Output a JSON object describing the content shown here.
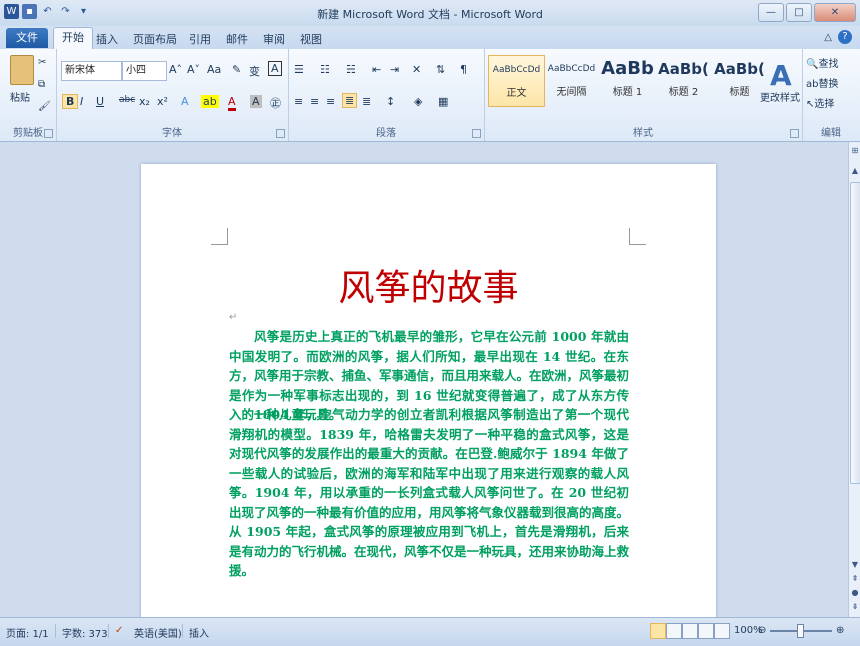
{
  "window": {
    "title": "新建 Microsoft Word 文档 - Microsoft Word",
    "controls": [
      "minimize-icon",
      "maximize-icon",
      "close-icon"
    ]
  },
  "quick_access": [
    "word-logo-icon",
    "save-icon",
    "undo-icon",
    "redo-icon",
    "customize-icon"
  ],
  "tabs": {
    "file": "文件",
    "items": [
      "开始",
      "插入",
      "页面布局",
      "引用",
      "邮件",
      "审阅",
      "视图"
    ],
    "active": "开始"
  },
  "ribbon": {
    "clipboard": {
      "paste": "粘贴",
      "label": "剪贴板"
    },
    "font": {
      "name": "新宋体",
      "size": "小四",
      "label": "字体",
      "buttons": [
        "B",
        "I",
        "U",
        "abc",
        "x₂",
        "x²",
        "A",
        "A",
        "A"
      ],
      "grow": "A˄",
      "shrink": "A˅",
      "case": "Aa",
      "pinyin": "变",
      "border": "A"
    },
    "paragraph": {
      "label": "段落"
    },
    "styles": {
      "label": "样式",
      "items": [
        {
          "sample": "AaBbCcDd",
          "name": "正文"
        },
        {
          "sample": "AaBbCcDd",
          "name": "无间隔"
        },
        {
          "sample": "AaBb",
          "name": "标题 1"
        },
        {
          "sample": "AaBb(",
          "name": "标题 2"
        },
        {
          "sample": "AaBb(",
          "name": "标题"
        }
      ],
      "change": "更改样式"
    },
    "editing": {
      "label": "编辑",
      "find": "查找",
      "replace": "替换",
      "select": "选择"
    }
  },
  "document": {
    "title": "风筝的故事",
    "paragraphs": [
      "风筝是历史上真正的飞机最早的雏形，它早在公元前 1000 年就由中国发明了。而欧洲的风筝，据人们所知，最早出现在 14 世纪。在东方，风筝用于宗教、捕鱼、军事通信，而且用来载人。在欧洲，风筝最初是作为一种军事标志出现的，到 16 世纪就变得普遍了，成了从东方传入的一种儿童玩具。",
      "1804 年，空气动力学的创立者凯利根据风筝制造出了第一个现代滑翔机的模型。1839 年，哈格雷夫发明了一种平稳的盒式风筝，这是对现代风筝的发展作出的最重大的贡献。在巴登.鲍威尔于 1894 年做了一些载人的试验后，欧洲的海军和陆军中出现了用来进行观察的载人风筝。1904 年，用以承重的一长列盒式载人风筝问世了。在 20 世纪初出现了风筝的一种最有价值的应用，用风筝将气象仪器载到很高的高度。从 1905 年起，盒式风筝的原理被应用到飞机上，首先是滑翔机，后来是有动力的飞行机械。在现代，风筝不仅是一种玩具，还用来协助海上救援。"
    ]
  },
  "status": {
    "page": "页面: 1/1",
    "words": "字数: 373",
    "language": "英语(美国)",
    "mode": "插入",
    "zoom": "100%"
  },
  "colors": {
    "title": "#c00000",
    "body": "#00a060",
    "accent": "#2b579a"
  }
}
